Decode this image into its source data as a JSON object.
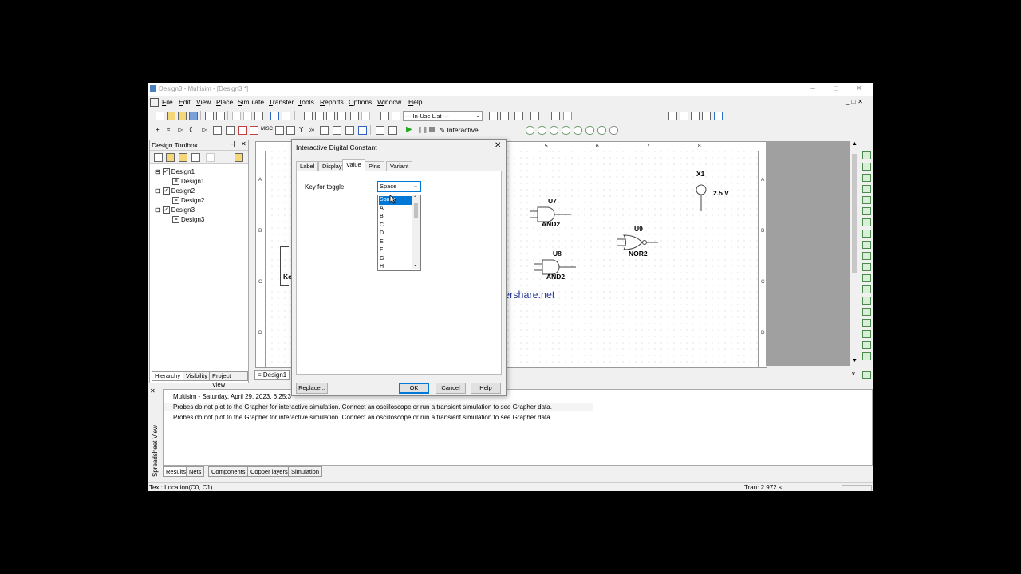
{
  "window": {
    "title": "Design3 - Multisim - [Design3 *]",
    "min_icon": "minimize-icon",
    "max_icon": "maximize-icon",
    "close_icon": "close-icon"
  },
  "menu": [
    "File",
    "Edit",
    "View",
    "Place",
    "Simulate",
    "Transfer",
    "Tools",
    "Reports",
    "Options",
    "Window",
    "Help"
  ],
  "toolbar": {
    "in_use_list": "--- In-Use List ---",
    "interactive_label": "Interactive"
  },
  "toolbox": {
    "title": "Design Toolbox",
    "tree": [
      {
        "label": "Design1",
        "child": "Design1"
      },
      {
        "label": "Design2",
        "child": "Design2"
      },
      {
        "label": "Design3",
        "child": "Design3"
      }
    ],
    "tabs": [
      "Hierarchy",
      "Visibility",
      "Project View"
    ]
  },
  "canvas": {
    "tab_label": "Design1",
    "col_numbers": [
      "5",
      "6",
      "7",
      "8"
    ],
    "row_letters": [
      "A",
      "B",
      "C",
      "D"
    ],
    "partial_label": "Ke",
    "components": {
      "u7_ref": "U7",
      "u7_type": "AND2",
      "u8_ref": "U8",
      "u8_type": "AND2",
      "u9_ref": "U9",
      "u9_type": "NOR2",
      "x1_ref": "X1",
      "x1_value": "2.5 V"
    },
    "watermark": "www.thundershare.net"
  },
  "dialog": {
    "title": "Interactive Digital Constant",
    "tabs": [
      "Label",
      "Display",
      "Value",
      "Pins",
      "Variant"
    ],
    "active_tab": "Value",
    "key_label": "Key for toggle",
    "key_value": "Space",
    "options": [
      "Space",
      "A",
      "B",
      "C",
      "D",
      "E",
      "F",
      "G",
      "H"
    ],
    "selected_option": "Space",
    "replace_label": "Replace...",
    "ok_label": "OK",
    "cancel_label": "Cancel",
    "help_label": "Help"
  },
  "spreadsheet": {
    "side_label": "Spreadsheet View",
    "lines": [
      "Multisim  -  Saturday, April 29, 2023, 6:25:3",
      "Probes do not plot to the Grapher for interactive simulation. Connect an oscilloscope or run a transient simulation to see Grapher data.",
      "Probes do not plot to the Grapher for interactive simulation. Connect an oscilloscope or run a transient simulation to see Grapher data."
    ],
    "tabs": [
      "Results",
      "Nets",
      "Components",
      "Copper layers",
      "Simulation"
    ]
  },
  "status": {
    "left": "Text: Location(C0, C1)",
    "right": "Tran: 2.972 s"
  }
}
